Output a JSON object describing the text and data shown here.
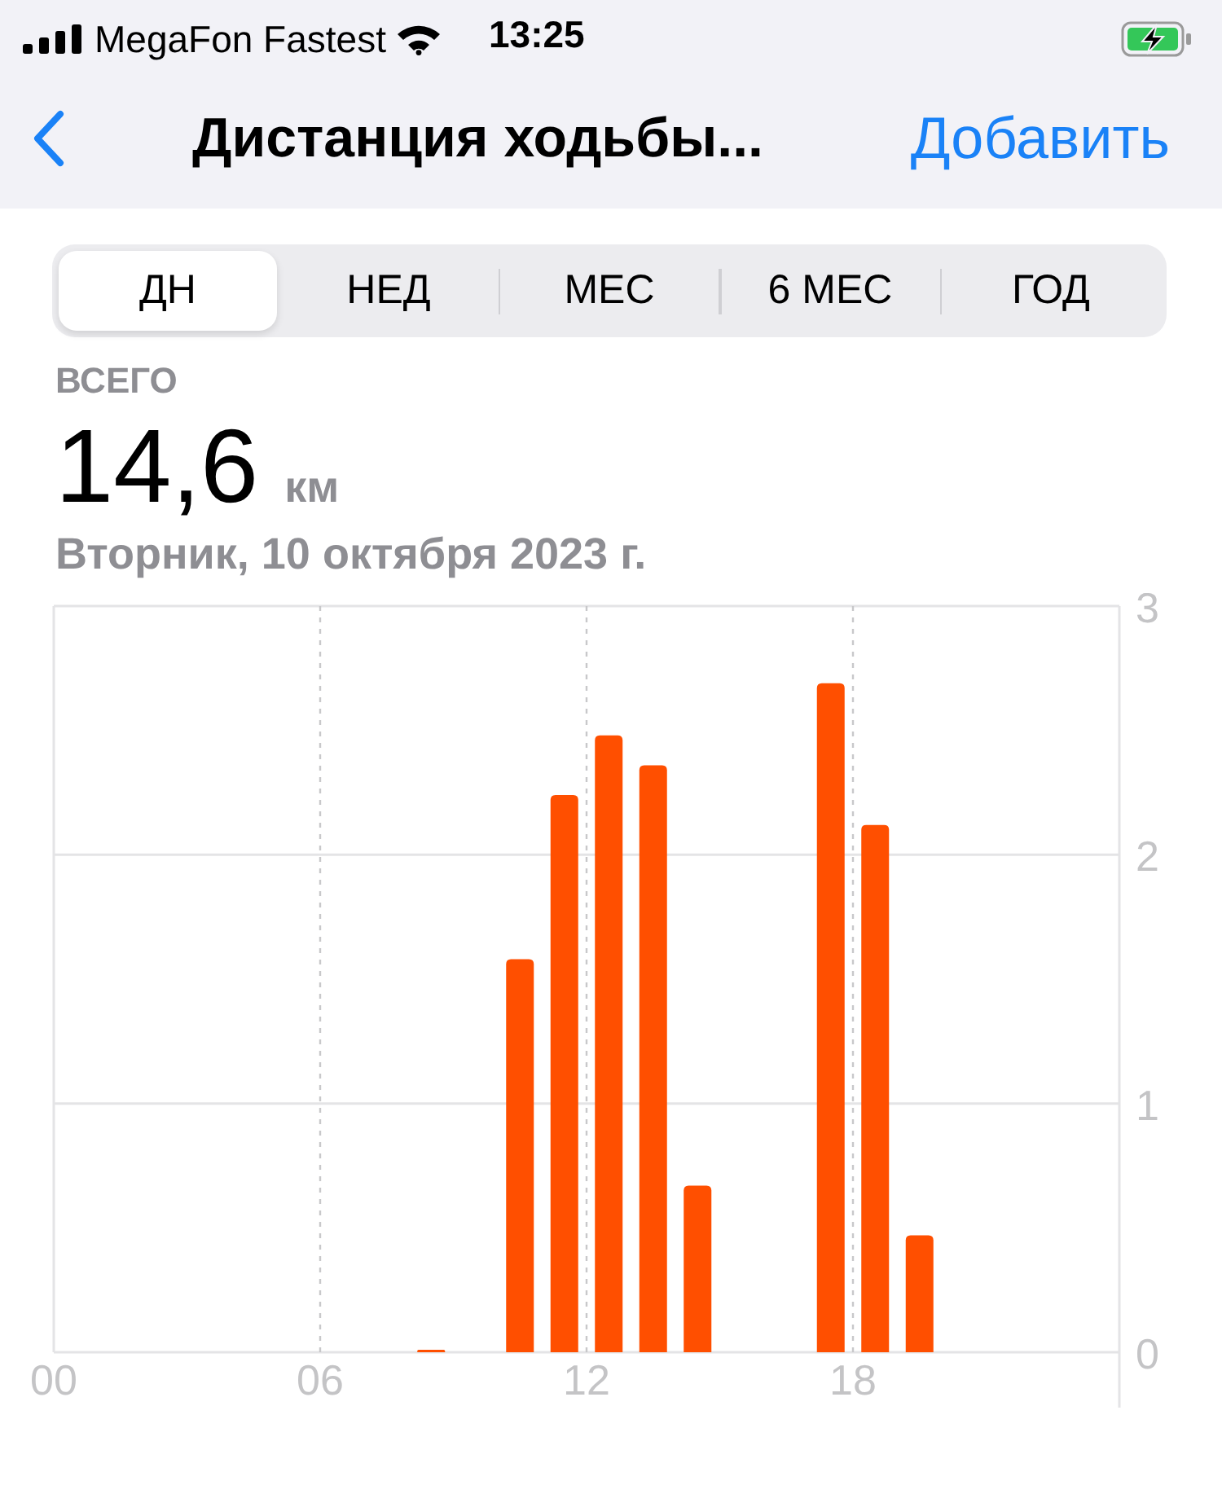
{
  "status_bar": {
    "carrier": "MegaFon Fastest",
    "time": "13:25",
    "charging": true
  },
  "nav": {
    "title": "Дистанция ходьбы...",
    "action": "Добавить"
  },
  "segments": [
    {
      "label": "ДН",
      "selected": true
    },
    {
      "label": "НЕД",
      "selected": false
    },
    {
      "label": "МЕС",
      "selected": false
    },
    {
      "label": "6 МЕС",
      "selected": false
    },
    {
      "label": "ГОД",
      "selected": false
    }
  ],
  "summary": {
    "caption": "ВСЕГО",
    "value": "14,6",
    "unit": "км",
    "date": "Вторник, 10 октября 2023 г."
  },
  "chart_data": {
    "type": "bar",
    "x": [
      8.5,
      10.5,
      11.5,
      12.5,
      13.5,
      14.5,
      17.5,
      18.5,
      19.5
    ],
    "series": [
      {
        "color": "#ff4f00",
        "values": [
          0.01,
          1.58,
          2.24,
          2.48,
          2.36,
          0.67,
          2.69,
          2.12,
          0.47
        ]
      }
    ],
    "xlim": [
      0,
      24
    ],
    "grid": true,
    "ylim": [
      0,
      3
    ],
    "yticks": [
      0,
      1,
      2,
      3
    ],
    "xticks": [
      {
        "value": 0,
        "label": "00"
      },
      {
        "value": 6,
        "label": "06"
      },
      {
        "value": 12,
        "label": "12"
      },
      {
        "value": 18,
        "label": "18"
      }
    ]
  }
}
